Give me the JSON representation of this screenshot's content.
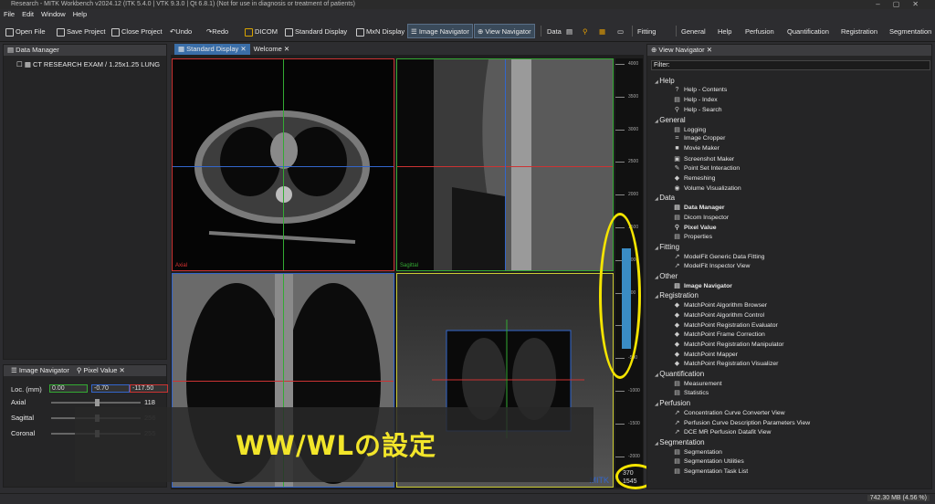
{
  "window": {
    "title": "Research - MITK Workbench v2024.12 (ITK 5.4.0 | VTK 9.3.0 | Qt 6.8.1) (Not for use in diagnosis or treatment of patients)"
  },
  "menu": [
    "File",
    "Edit",
    "Window",
    "Help"
  ],
  "toolbar": {
    "open": "Open File",
    "save": "Save Project",
    "close": "Close Project",
    "undo": "Undo",
    "redo": "Redo",
    "dicom": "DICOM",
    "standard": "Standard Display",
    "mxn": "MxN Display",
    "imgnav": "Image Navigator",
    "viewnav": "View Navigator",
    "data": "Data",
    "fitting": "Fitting",
    "general": "General",
    "help": "Help",
    "perfusion": "Perfusion",
    "quant": "Quantification",
    "registration": "Registration",
    "segmentation": "Segmentation"
  },
  "data_manager": {
    "title": "Data Manager",
    "node": "CT RESEARCH EXAM / 1.25x1.25 LUNG"
  },
  "nav_panel": {
    "tab1": "Image Navigator",
    "tab2": "Pixel Value",
    "loc_label": "Loc. (mm)",
    "loc_x": "0.00",
    "loc_y": "-0.70",
    "loc_z": "-117.50",
    "axial_label": "Axial",
    "axial_val": "118",
    "sagittal_label": "Sagittal",
    "sagittal_val": "256",
    "coronal_label": "Coronal",
    "coronal_val": "255"
  },
  "viewer": {
    "tab_standard": "Standard Display",
    "tab_welcome": "Welcome",
    "label_axial": "Axial",
    "label_sagittal": "Sagittal",
    "mitk_logo": "MITK"
  },
  "levelwindow": {
    "ticks": [
      "4000",
      "3500",
      "3000",
      "2500",
      "2000",
      "1500",
      "1000",
      "500",
      "0",
      "-500",
      "-1000",
      "-1500",
      "-2000"
    ],
    "ww": "370",
    "wl": "1545"
  },
  "annotation": {
    "text": "WW/WLの設定"
  },
  "view_navigator": {
    "title": "View Navigator",
    "filter": "Filter:",
    "groups": [
      {
        "name": "Help",
        "items": [
          {
            "label": "Help - Contents",
            "icon": "?"
          },
          {
            "label": "Help - Index",
            "icon": "▤"
          },
          {
            "label": "Help - Search",
            "icon": "⚲"
          }
        ]
      },
      {
        "name": "General",
        "items": [
          {
            "label": "Logging",
            "icon": "▤"
          },
          {
            "label": "Image Cropper",
            "icon": "⌗"
          },
          {
            "label": "Movie Maker",
            "icon": "■"
          },
          {
            "label": "Screenshot Maker",
            "icon": "▣"
          },
          {
            "label": "Point Set Interaction",
            "icon": "✎"
          },
          {
            "label": "Remeshing",
            "icon": "◆"
          },
          {
            "label": "Volume Visualization",
            "icon": "◉"
          }
        ]
      },
      {
        "name": "Data",
        "items": [
          {
            "label": "Data Manager",
            "icon": "▤",
            "bold": true
          },
          {
            "label": "Dicom Inspector",
            "icon": "▤"
          },
          {
            "label": "Pixel Value",
            "icon": "⚲",
            "bold": true
          },
          {
            "label": "Properties",
            "icon": "▤"
          }
        ]
      },
      {
        "name": "Fitting",
        "items": [
          {
            "label": "ModelFit Generic Data Fitting",
            "icon": "↗"
          },
          {
            "label": "ModelFit Inspector View",
            "icon": "↗"
          }
        ]
      },
      {
        "name": "Other",
        "items": [
          {
            "label": "Image Navigator",
            "icon": "▤",
            "bold": true
          }
        ]
      },
      {
        "name": "Registration",
        "items": [
          {
            "label": "MatchPoint Algorithm Browser",
            "icon": "◆"
          },
          {
            "label": "MatchPoint Algorithm Control",
            "icon": "◆"
          },
          {
            "label": "MatchPoint Registration Evaluator",
            "icon": "◆"
          },
          {
            "label": "MatchPoint Frame Correction",
            "icon": "◆"
          },
          {
            "label": "MatchPoint Registration Manipulator",
            "icon": "◆"
          },
          {
            "label": "MatchPoint Mapper",
            "icon": "◆"
          },
          {
            "label": "MatchPoint Registration Visualizer",
            "icon": "◆"
          }
        ]
      },
      {
        "name": "Quantification",
        "items": [
          {
            "label": "Measurement",
            "icon": "▤"
          },
          {
            "label": "Statistics",
            "icon": "▤"
          }
        ]
      },
      {
        "name": "Perfusion",
        "items": [
          {
            "label": "Concentration Curve Converter View",
            "icon": "↗"
          },
          {
            "label": "Perfusion Curve Description Parameters View",
            "icon": "↗"
          },
          {
            "label": "DCE MR Perfusion Datafit View",
            "icon": "↗"
          }
        ]
      },
      {
        "name": "Segmentation",
        "items": [
          {
            "label": "Segmentation",
            "icon": "▤"
          },
          {
            "label": "Segmentation Utilities",
            "icon": "▤"
          },
          {
            "label": "Segmentation Task List",
            "icon": "▤"
          }
        ]
      }
    ]
  },
  "status": {
    "memory": "742.30 MB (4.56 %)"
  }
}
